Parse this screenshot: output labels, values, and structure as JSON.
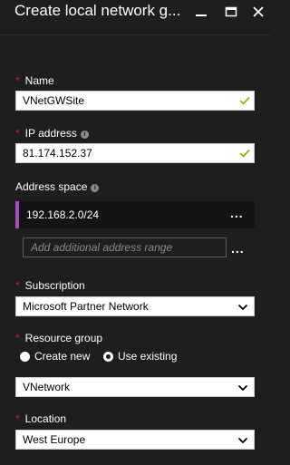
{
  "window": {
    "title": "Create local network g..."
  },
  "form": {
    "name": {
      "label": "Name",
      "value": "VNetGWSite",
      "required": true,
      "valid": true
    },
    "ip_address": {
      "label": "IP address",
      "value": "81.174.152.37",
      "required": true,
      "valid": true
    },
    "address_space": {
      "label": "Address space",
      "ranges": [
        "192.168.2.0/24"
      ],
      "more": "...",
      "add_placeholder": "Add additional address range"
    },
    "subscription": {
      "label": "Subscription",
      "value": "Microsoft Partner Network",
      "required": true
    },
    "resource_group": {
      "label": "Resource group",
      "required": true,
      "options": [
        {
          "label": "Create new",
          "selected": false
        },
        {
          "label": "Use existing",
          "selected": true
        }
      ],
      "value": "VNetwork"
    },
    "location": {
      "label": "Location",
      "value": "West Europe",
      "required": true
    }
  },
  "icons": {
    "info": "i",
    "accent_color": "#b146c2",
    "valid_color": "#7fba00",
    "required_color": "#e81123"
  }
}
